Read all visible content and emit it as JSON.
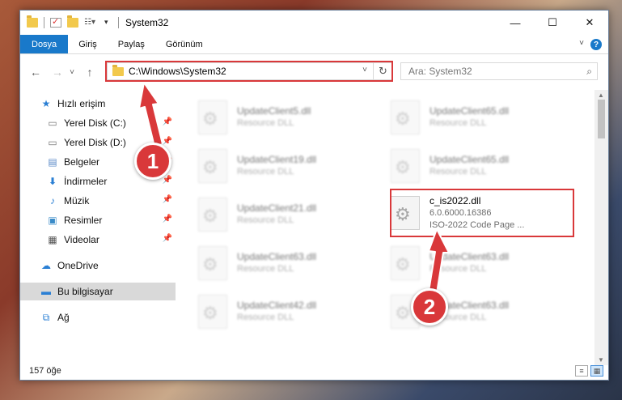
{
  "window": {
    "title": "System32"
  },
  "ribbon": {
    "tabs": [
      {
        "label": "Dosya"
      },
      {
        "label": "Giriş"
      },
      {
        "label": "Paylaş"
      },
      {
        "label": "Görünüm"
      }
    ],
    "help": "?"
  },
  "nav": {
    "back": "←",
    "forward": "→",
    "recent": "˅",
    "up": "↑"
  },
  "address": {
    "path": "C:\\Windows\\System32",
    "chevron": "˅",
    "refresh": "↻"
  },
  "search": {
    "placeholder": "Ara: System32",
    "icon": "search-icon"
  },
  "navpane": {
    "items": [
      {
        "label": "Hızlı erişim",
        "icon": "star-icon"
      },
      {
        "label": "Yerel Disk (C:)",
        "icon": "drive-icon"
      },
      {
        "label": "Yerel Disk (D:)",
        "icon": "drive-icon"
      },
      {
        "label": "Belgeler",
        "icon": "documents-icon"
      },
      {
        "label": "İndirmeler",
        "icon": "download-icon"
      },
      {
        "label": "Müzik",
        "icon": "music-icon"
      },
      {
        "label": "Resimler",
        "icon": "pictures-icon"
      },
      {
        "label": "Videolar",
        "icon": "video-icon"
      },
      {
        "label": "OneDrive",
        "icon": "cloud-icon"
      },
      {
        "label": "Bu bilgisayar",
        "icon": "computer-icon"
      },
      {
        "label": "Ağ",
        "icon": "network-icon"
      }
    ]
  },
  "files": [
    {
      "name": "UpdateClient5.dll",
      "sub": "Resource DLL"
    },
    {
      "name": "UpdateClient65.dll",
      "sub": "Resource DLL"
    },
    {
      "name": "UpdateClient19.dll",
      "sub": "Resource DLL"
    },
    {
      "name": "UpdateClient65.dll",
      "sub": "Resource DLL"
    },
    {
      "name": "UpdateClient21.dll",
      "sub": "Resource DLL"
    },
    {
      "name": "c_is2022.dll",
      "sub": "6.0.6000.16386",
      "sub2": "ISO-2022 Code Page ..."
    },
    {
      "name": "UpdateClient63.dll",
      "sub": "Resource DLL"
    },
    {
      "name": "UpdateClient63.dll",
      "sub": "Resource DLL"
    },
    {
      "name": "UpdateClient42.dll",
      "sub": "Resource DLL"
    },
    {
      "name": "UpdateClient63.dll",
      "sub": "Resource DLL"
    }
  ],
  "status": {
    "count": "157 öğe"
  },
  "badges": {
    "one": "1",
    "two": "2"
  },
  "colors": {
    "accent": "#1979ca",
    "highlight": "#d9383a"
  }
}
